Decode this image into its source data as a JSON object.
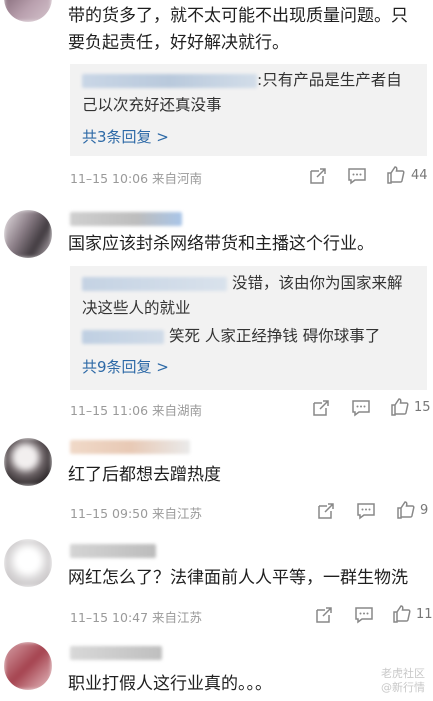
{
  "comments": [
    {
      "text": "带的货多了，就不太可能不出现质量问题。只要负起责任，好好解决就行。",
      "replies": [
        "只有产品是生产者自己以次充好还真没事"
      ],
      "reply_prefix": ":",
      "more": "共3条回复 >",
      "time": "11–15 10:06",
      "source": "来自河南",
      "likes": "44"
    },
    {
      "text": "国家应该封杀网络带货和主播这个行业。",
      "replies": [
        "没错，该由你为国家来解决这些人的就业",
        "笑死  人家正经挣钱  碍你球事了"
      ],
      "more": "共9条回复 >",
      "time": "11–15 11:06",
      "source": "来自湖南",
      "likes": "15"
    },
    {
      "text": "红了后都想去蹭热度",
      "time": "11–15 09:50",
      "source": "来自江苏",
      "likes": "9"
    },
    {
      "text": "网红怎么了？法律面前人人平等，一群生物洗",
      "time": "11–15 10:47",
      "source": "来自江苏",
      "likes": "11"
    },
    {
      "text": "职业打假人这行业真的。。。"
    }
  ],
  "watermark": {
    "line1": "老虎社区",
    "line2": "@新行情"
  },
  "icons": [
    "share-icon",
    "comment-icon",
    "like-icon"
  ],
  "colors": {
    "link": "#2e6aa7",
    "meta": "#9a9a9a",
    "replybg": "#f2f2f2"
  }
}
